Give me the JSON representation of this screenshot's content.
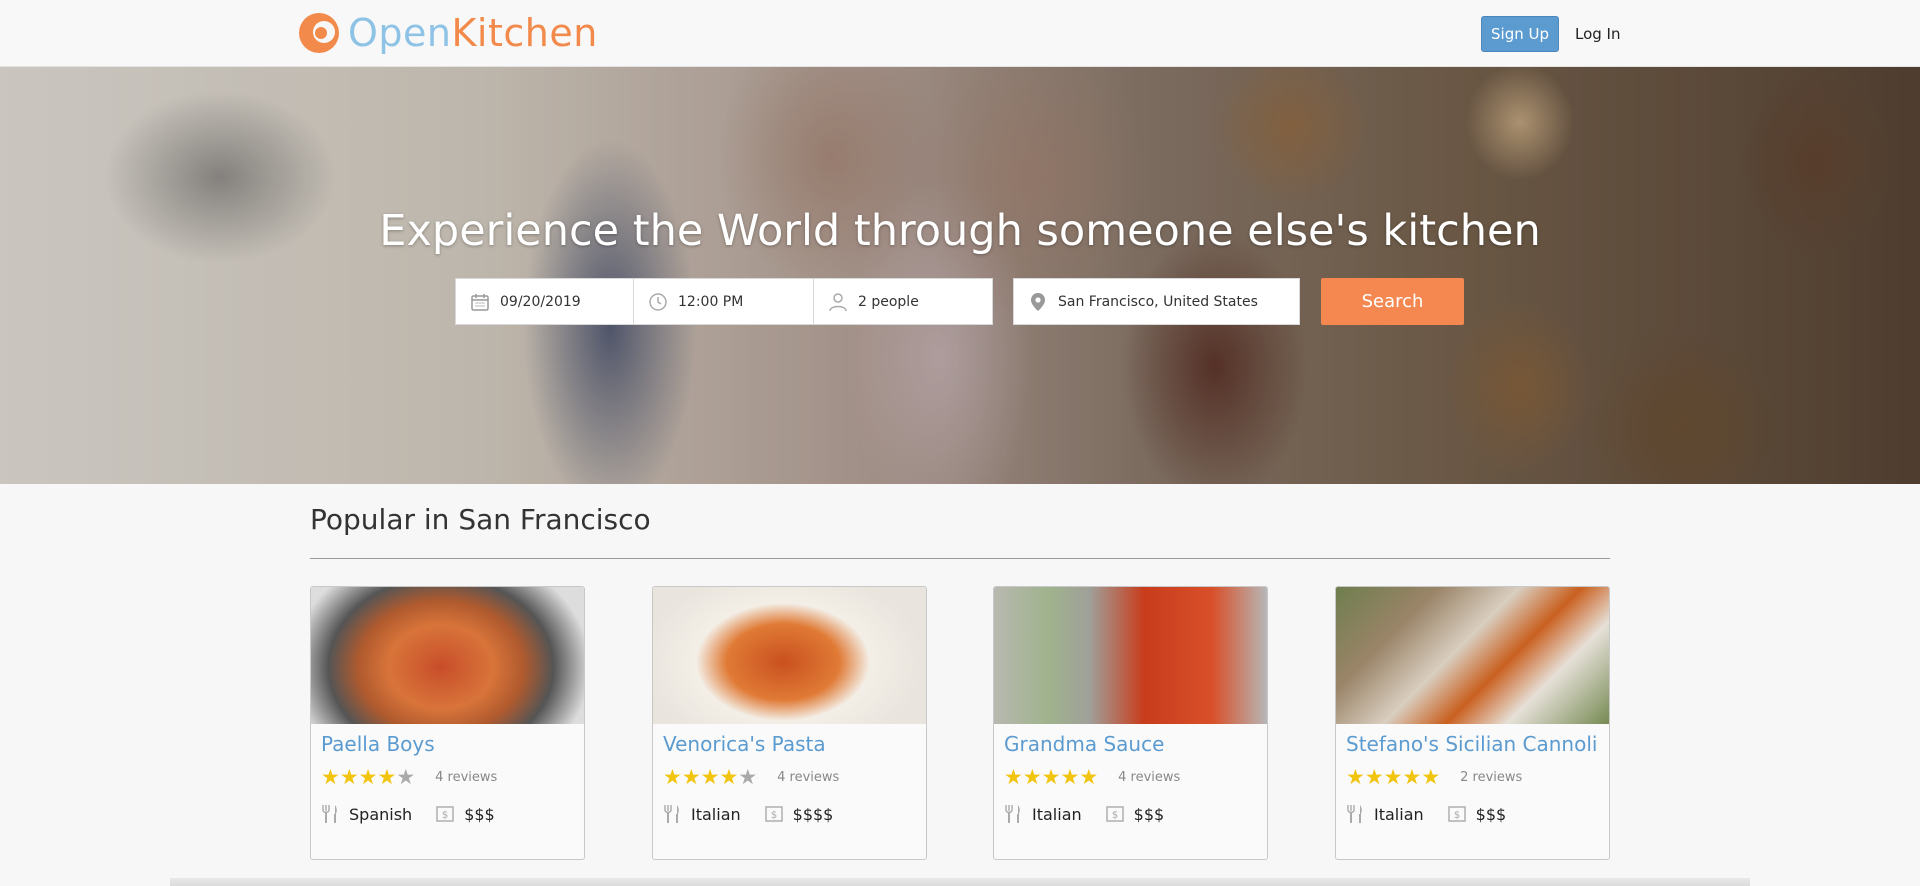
{
  "header": {
    "logo_part1": "Open",
    "logo_part2": "Kitchen",
    "signup_label": "Sign Up",
    "login_label": "Log In"
  },
  "hero": {
    "title": "Experience the World through someone else's kitchen",
    "date_value": "09/20/2019",
    "time_value": "12:00 PM",
    "people_value": "2 people",
    "location_value": "San Francisco, United States",
    "search_label": "Search"
  },
  "section": {
    "title": "Popular in San Francisco"
  },
  "cards": [
    {
      "name": "Paella Boys",
      "rating": 4,
      "reviews": "4 reviews",
      "cuisine": "Spanish",
      "price": "$$$"
    },
    {
      "name": "Venorica's Pasta",
      "rating": 4,
      "reviews": "4 reviews",
      "cuisine": "Italian",
      "price": "$$$$"
    },
    {
      "name": "Grandma Sauce",
      "rating": 5,
      "reviews": "4 reviews",
      "cuisine": "Italian",
      "price": "$$$"
    },
    {
      "name": "Stefano's Sicilian Cannoli",
      "rating": 5,
      "reviews": "2 reviews",
      "cuisine": "Italian",
      "price": "$$$"
    }
  ],
  "colors": {
    "accent_orange": "#f48850",
    "accent_blue": "#5b9bd0",
    "star": "#f1c40f"
  },
  "icons": {
    "date": "calendar-icon",
    "time": "clock-icon",
    "people": "person-icon",
    "location": "map-pin-icon",
    "cuisine": "fork-knife-icon",
    "price": "dollar-bill-icon"
  }
}
